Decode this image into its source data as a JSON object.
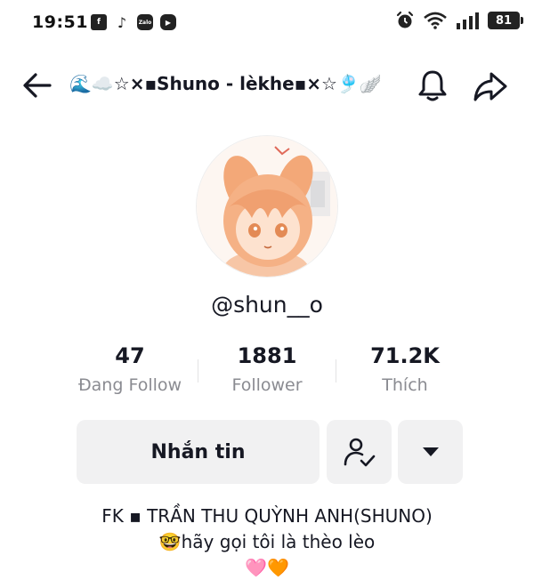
{
  "status_bar": {
    "time": "19:51",
    "battery": "81",
    "notifications": [
      "facebook-icon",
      "tiktok-icon",
      "zalo-icon",
      "youtube-icon"
    ],
    "zalo_label": "Zalo"
  },
  "header": {
    "title": "🌊☁️☆×▪Shuno - lèkhe▪×☆🎐🪽"
  },
  "profile": {
    "username": "@shun__o"
  },
  "stats": [
    {
      "value": "47",
      "label": "Đang Follow"
    },
    {
      "value": "1881",
      "label": "Follower"
    },
    {
      "value": "71.2K",
      "label": "Thích"
    }
  ],
  "actions": {
    "message_label": "Nhắn tin"
  },
  "bio": {
    "line1": "FK ▪ TRẦN THU QUỲNH ANH(SHUNO)",
    "line2": "🤓hãy gọi tôi là thèo lèo",
    "line3": "🩷🧡"
  },
  "colors": {
    "text_primary": "#161823",
    "text_secondary": "#8a8b91",
    "button_bg": "#f1f1f2"
  }
}
